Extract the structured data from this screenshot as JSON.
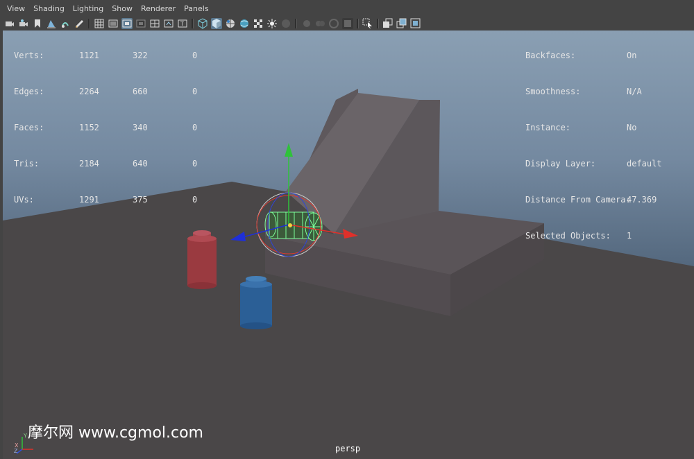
{
  "menu": [
    "View",
    "Shading",
    "Lighting",
    "Show",
    "Renderer",
    "Panels"
  ],
  "toolbar_icons": [
    "camera-select-icon",
    "camera-attributes-icon",
    "bookmark-icon",
    "image-plane-icon",
    "two-d-pan-icon",
    "grease-pencil-icon",
    "grid-icon",
    "film-gate-icon",
    "resolution-gate-icon",
    "gate-mask-icon",
    "field-chart-icon",
    "safe-action-icon",
    "safe-title-icon",
    "wireframe-icon",
    "smooth-shade-icon",
    "wireframe-on-shaded-icon",
    "textured-icon",
    "use-all-lights-icon",
    "shadows-icon",
    "screen-space-ao-icon",
    "motion-blur-icon",
    "multisample-aa-icon",
    "depth-of-field-icon",
    "isolate-select-icon",
    "xray-icon",
    "xray-joints-icon",
    "xray-components-icon"
  ],
  "stats": {
    "rows": [
      {
        "label": "Verts:",
        "a": "1121",
        "b": "322",
        "c": "0"
      },
      {
        "label": "Edges:",
        "a": "2264",
        "b": "660",
        "c": "0"
      },
      {
        "label": "Faces:",
        "a": "1152",
        "b": "340",
        "c": "0"
      },
      {
        "label": "Tris:",
        "a": "2184",
        "b": "640",
        "c": "0"
      },
      {
        "label": "UVs:",
        "a": "1291",
        "b": "375",
        "c": "0"
      }
    ]
  },
  "info": {
    "rows": [
      {
        "label": "Backfaces:",
        "value": "On"
      },
      {
        "label": "Smoothness:",
        "value": "N/A"
      },
      {
        "label": "Instance:",
        "value": "No"
      },
      {
        "label": "Display Layer:",
        "value": "default"
      },
      {
        "label": "Distance From Camera:",
        "value": "47.369"
      },
      {
        "label": "Selected Objects:",
        "value": "1"
      }
    ]
  },
  "camera_label": "persp",
  "watermark": "摩尔网 www.cgmol.com",
  "axis": {
    "y": "Y",
    "x": "X",
    "z": "Z"
  },
  "colors": {
    "selection": "#7dff9a",
    "manip_x": "#e0302a",
    "manip_y": "#2fc23a",
    "manip_z": "#1f2fd8"
  }
}
